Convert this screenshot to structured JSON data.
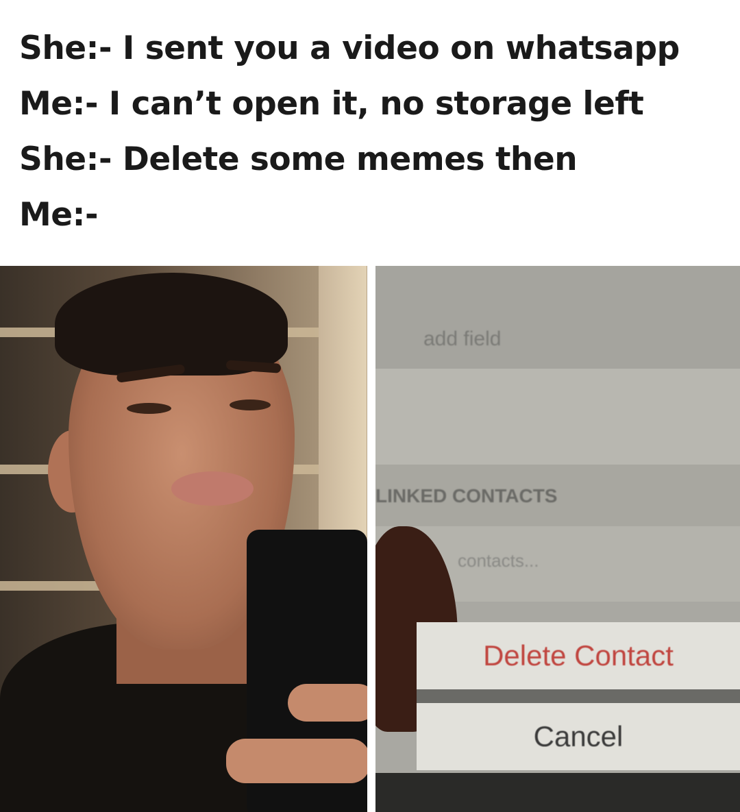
{
  "caption": {
    "lines": [
      "She:- I sent you a video on whatsapp",
      "Me:- I can’t open it, no storage left",
      "She:- Delete some memes then",
      "Me:-"
    ]
  },
  "phone_screen": {
    "add_field_label": "add field",
    "linked_contacts_header": "LINKED CONTACTS",
    "link_contacts_label": "contacts...",
    "delete_button_label": "Delete Contact",
    "cancel_button_label": "Cancel",
    "colors": {
      "delete": "#c0453f",
      "cancel": "#3a3a3a"
    }
  }
}
